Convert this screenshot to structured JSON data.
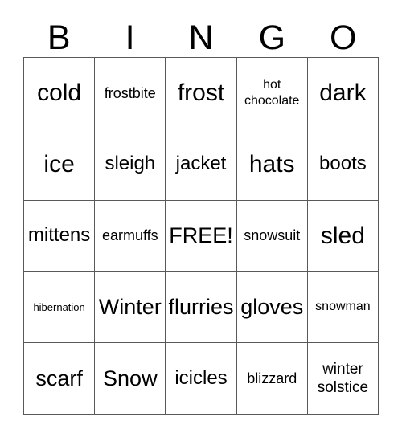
{
  "card": {
    "header_letters": [
      "B",
      "I",
      "N",
      "G",
      "O"
    ],
    "columns": [
      {
        "letter": "B",
        "cells": [
          "cold",
          "ice",
          "mittens",
          "hibernation",
          "scarf"
        ]
      },
      {
        "letter": "I",
        "cells": [
          "frostbite",
          "sleigh",
          "earmuffs",
          "Winter",
          "Snow"
        ]
      },
      {
        "letter": "N",
        "cells": [
          "frost",
          "jacket",
          "FREE!",
          "flurries",
          "icicles"
        ]
      },
      {
        "letter": "G",
        "cells": [
          "hot chocolate",
          "hats",
          "snowsuit",
          "gloves",
          "blizzard"
        ]
      },
      {
        "letter": "O",
        "cells": [
          "dark",
          "boots",
          "sled",
          "snowman",
          "winter solstice"
        ]
      }
    ],
    "rows": [
      [
        "cold",
        "frostbite",
        "frost",
        "hot\nchocolate",
        "dark"
      ],
      [
        "ice",
        "sleigh",
        "jacket",
        "hats",
        "boots"
      ],
      [
        "mittens",
        "earmuffs",
        "FREE!",
        "snowsuit",
        "sled"
      ],
      [
        "hibernation",
        "Winter",
        "flurries",
        "gloves",
        "snowman"
      ],
      [
        "scarf",
        "Snow",
        "icicles",
        "blizzard",
        "winter\nsolstice"
      ]
    ],
    "free_space": "FREE!",
    "free_space_position": {
      "row": 3,
      "column": 3
    },
    "grid_size": "5x5",
    "colors": {
      "border": "#595959",
      "background": "#ffffff",
      "text": "#000000"
    }
  }
}
